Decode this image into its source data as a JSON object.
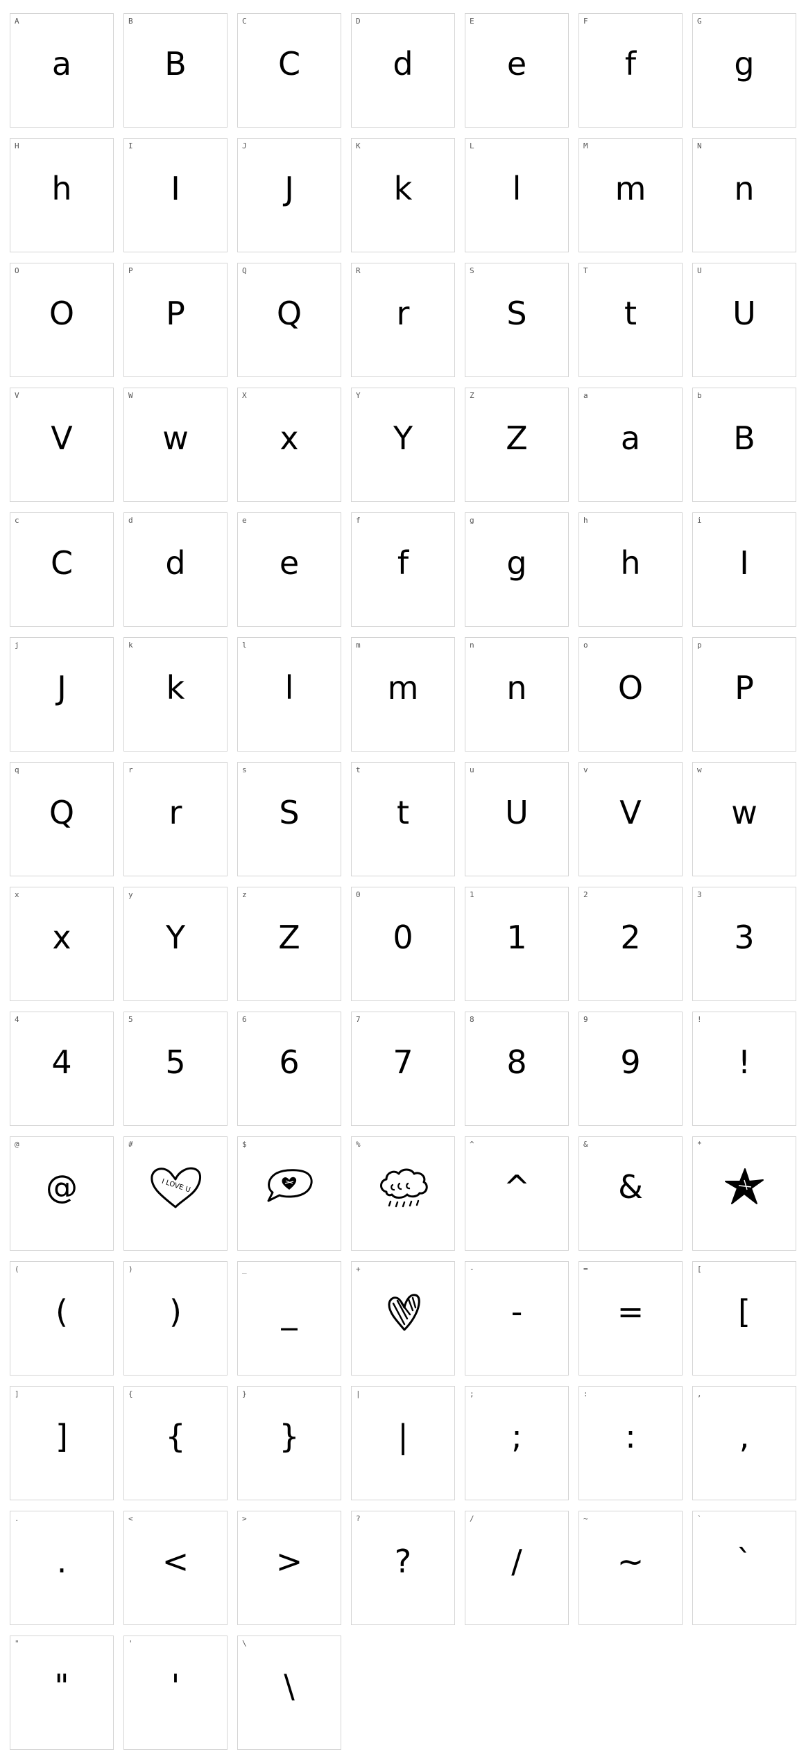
{
  "colors": {
    "cell_border": "#d4d4d4",
    "label": "#555555",
    "glyph": "#000000",
    "background": "#ffffff"
  },
  "cells": [
    {
      "label": "A",
      "glyph": "a"
    },
    {
      "label": "B",
      "glyph": "B"
    },
    {
      "label": "C",
      "glyph": "C"
    },
    {
      "label": "D",
      "glyph": "d"
    },
    {
      "label": "E",
      "glyph": "e"
    },
    {
      "label": "F",
      "glyph": "f"
    },
    {
      "label": "G",
      "glyph": "g"
    },
    {
      "label": "H",
      "glyph": "h"
    },
    {
      "label": "I",
      "glyph": "I"
    },
    {
      "label": "J",
      "glyph": "J"
    },
    {
      "label": "K",
      "glyph": "k"
    },
    {
      "label": "L",
      "glyph": "l"
    },
    {
      "label": "M",
      "glyph": "m"
    },
    {
      "label": "N",
      "glyph": "n"
    },
    {
      "label": "O",
      "glyph": "O"
    },
    {
      "label": "P",
      "glyph": "P"
    },
    {
      "label": "Q",
      "glyph": "Q"
    },
    {
      "label": "R",
      "glyph": "r"
    },
    {
      "label": "S",
      "glyph": "S"
    },
    {
      "label": "T",
      "glyph": "t"
    },
    {
      "label": "U",
      "glyph": "U"
    },
    {
      "label": "V",
      "glyph": "V"
    },
    {
      "label": "W",
      "glyph": "w"
    },
    {
      "label": "X",
      "glyph": "x"
    },
    {
      "label": "Y",
      "glyph": "Y"
    },
    {
      "label": "Z",
      "glyph": "Z"
    },
    {
      "label": "a",
      "glyph": "a"
    },
    {
      "label": "b",
      "glyph": "B"
    },
    {
      "label": "c",
      "glyph": "C"
    },
    {
      "label": "d",
      "glyph": "d"
    },
    {
      "label": "e",
      "glyph": "e"
    },
    {
      "label": "f",
      "glyph": "f"
    },
    {
      "label": "g",
      "glyph": "g"
    },
    {
      "label": "h",
      "glyph": "h"
    },
    {
      "label": "i",
      "glyph": "I"
    },
    {
      "label": "j",
      "glyph": "J"
    },
    {
      "label": "k",
      "glyph": "k"
    },
    {
      "label": "l",
      "glyph": "l"
    },
    {
      "label": "m",
      "glyph": "m"
    },
    {
      "label": "n",
      "glyph": "n"
    },
    {
      "label": "o",
      "glyph": "O"
    },
    {
      "label": "p",
      "glyph": "P"
    },
    {
      "label": "q",
      "glyph": "Q"
    },
    {
      "label": "r",
      "glyph": "r"
    },
    {
      "label": "s",
      "glyph": "S"
    },
    {
      "label": "t",
      "glyph": "t"
    },
    {
      "label": "u",
      "glyph": "U"
    },
    {
      "label": "v",
      "glyph": "V"
    },
    {
      "label": "w",
      "glyph": "w"
    },
    {
      "label": "x",
      "glyph": "x"
    },
    {
      "label": "y",
      "glyph": "Y"
    },
    {
      "label": "z",
      "glyph": "Z"
    },
    {
      "label": "0",
      "glyph": "0"
    },
    {
      "label": "1",
      "glyph": "1"
    },
    {
      "label": "2",
      "glyph": "2"
    },
    {
      "label": "3",
      "glyph": "3"
    },
    {
      "label": "4",
      "glyph": "4"
    },
    {
      "label": "5",
      "glyph": "5"
    },
    {
      "label": "6",
      "glyph": "6"
    },
    {
      "label": "7",
      "glyph": "7"
    },
    {
      "label": "8",
      "glyph": "8"
    },
    {
      "label": "9",
      "glyph": "9"
    },
    {
      "label": "!",
      "glyph": "!"
    },
    {
      "label": "@",
      "glyph": "@"
    },
    {
      "label": "#",
      "icon": "heart-i-love-u-icon",
      "icon_text": "I LOVE U"
    },
    {
      "label": "$",
      "icon": "speech-bubble-heart-icon"
    },
    {
      "label": "%",
      "icon": "rain-cloud-icon"
    },
    {
      "label": "^",
      "glyph": "^"
    },
    {
      "label": "&",
      "glyph": "&"
    },
    {
      "label": "*",
      "icon": "star-icon"
    },
    {
      "label": "(",
      "glyph": "("
    },
    {
      "label": ")",
      "glyph": ")"
    },
    {
      "label": "_",
      "glyph": "_"
    },
    {
      "label": "+",
      "icon": "striped-heart-icon"
    },
    {
      "label": "-",
      "glyph": "-"
    },
    {
      "label": "=",
      "glyph": "="
    },
    {
      "label": "[",
      "glyph": "["
    },
    {
      "label": "]",
      "glyph": "]"
    },
    {
      "label": "{",
      "glyph": "{"
    },
    {
      "label": "}",
      "glyph": "}"
    },
    {
      "label": "|",
      "glyph": "|"
    },
    {
      "label": ";",
      "glyph": ";"
    },
    {
      "label": ":",
      "glyph": ":"
    },
    {
      "label": ",",
      "glyph": ","
    },
    {
      "label": ".",
      "glyph": "."
    },
    {
      "label": "<",
      "glyph": "<"
    },
    {
      "label": ">",
      "glyph": ">"
    },
    {
      "label": "?",
      "glyph": "?"
    },
    {
      "label": "/",
      "glyph": "/"
    },
    {
      "label": "~",
      "glyph": "~"
    },
    {
      "label": "`",
      "glyph": "`"
    },
    {
      "label": "\"",
      "glyph": "\""
    },
    {
      "label": "'",
      "glyph": "'"
    },
    {
      "label": "\\",
      "glyph": "\\"
    }
  ]
}
